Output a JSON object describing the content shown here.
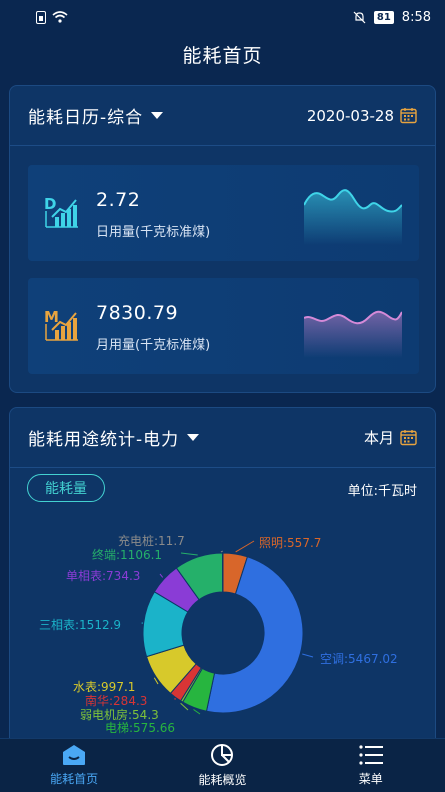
{
  "status": {
    "time": "8:58",
    "battery": "81"
  },
  "header": {
    "title": "能耗首页"
  },
  "calendar_card": {
    "title": "能耗日历-综合",
    "date": "2020-03-28",
    "daily": {
      "value": "2.72",
      "label": "日用量(千克标准煤)",
      "icon_letter": "D",
      "color": "#3fd4e8"
    },
    "monthly": {
      "value": "7830.79",
      "label": "月用量(千克标准煤)",
      "icon_letter": "M",
      "color": "#e8a43f",
      "spark_color": "#d58ad8"
    }
  },
  "usage_card": {
    "title": "能耗用途统计-电力",
    "period": "本月",
    "tab": "能耗量",
    "unit": "单位:千瓦时",
    "chart_data": {
      "type": "pie",
      "variant": "donut",
      "slices": [
        {
          "name": "空调",
          "value": 5467.02,
          "label": "空调:5467.02",
          "color": "#2f6fe0"
        },
        {
          "name": "电梯",
          "value": 575.66,
          "label": "电梯:575.66",
          "color": "#27b53f"
        },
        {
          "name": "弱电机房",
          "value": 54.3,
          "label": "弱电机房:54.3",
          "color": "#7ec23a"
        },
        {
          "name": "南华",
          "value": 284.3,
          "label": "南华:284.3",
          "color": "#d83535"
        },
        {
          "name": "水表",
          "value": 997.1,
          "label": "水表:997.1",
          "color": "#d7c92b"
        },
        {
          "name": "三相表",
          "value": 1512.9,
          "label": "三相表:1512.9",
          "color": "#1bb3c9"
        },
        {
          "name": "单相表",
          "value": 734.3,
          "label": "单相表:734.3",
          "color": "#8a3cd6"
        },
        {
          "name": "终端",
          "value": 1106.1,
          "label": "终端:1106.1",
          "color": "#25b06a"
        },
        {
          "name": "充电桩",
          "value": 11.7,
          "label": "充电桩:11.7",
          "color": "#8a8a8a"
        },
        {
          "name": "照明",
          "value": 557.7,
          "label": "照明:557.7",
          "color": "#d8662a"
        }
      ]
    }
  },
  "nav": {
    "items": [
      {
        "label": "能耗首页"
      },
      {
        "label": "能耗概览"
      },
      {
        "label": "菜单"
      }
    ]
  }
}
